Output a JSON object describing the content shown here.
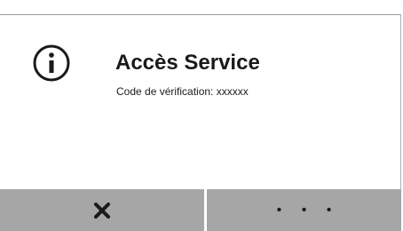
{
  "dialog": {
    "title": "Accès Service",
    "message": "Code de vérification: xxxxxx",
    "icon": "info-icon"
  },
  "buttons": {
    "cancel_icon": "close-icon",
    "more_label": "• • •"
  },
  "colors": {
    "background": "#ffffff",
    "button": "#a6a6a6",
    "text": "#1a1a1a"
  }
}
